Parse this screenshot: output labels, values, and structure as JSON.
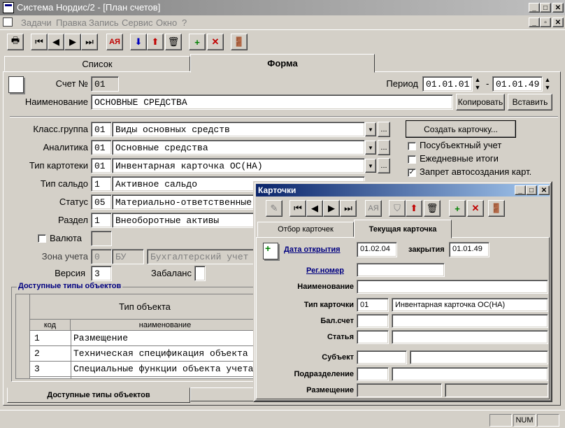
{
  "app": {
    "title": "Система Нордис/2 - [План счетов]",
    "menu": [
      "Задачи",
      "Правка",
      "Запись",
      "Сервис",
      "Окно",
      "?"
    ]
  },
  "tabs": {
    "list": "Список",
    "form": "Форма"
  },
  "form": {
    "account_label": "Счет №",
    "account_value": "01",
    "period_label": "Период",
    "period_from": "01.01.01",
    "period_sep": "-",
    "period_to": "01.01.49",
    "name_label": "Наименование",
    "name_value": "ОСНОВНЫЕ СРЕДСТВА",
    "copy_button": "Копировать",
    "paste_button": "Вставить",
    "class_group_label": "Класс.группа",
    "class_group_code": "01",
    "class_group_value": "Виды основных средств",
    "analytics_label": "Аналитика",
    "analytics_code": "01",
    "analytics_value": "Основные средства",
    "card_type_label": "Тип картотеки",
    "card_type_code": "01",
    "card_type_value": "Инвентарная карточка ОС(НА)",
    "balance_type_label": "Тип сальдо",
    "balance_type_code": "1",
    "balance_type_value": "Активное сальдо",
    "status_label": "Статус",
    "status_code": "05",
    "status_value": "Материально-ответственные",
    "section_label": "Раздел",
    "section_code": "1",
    "section_value": "Внеоборотные активы",
    "currency_label": "Валюта",
    "zone_label": "Зона учета",
    "zone_code": "0",
    "zone_short": "БУ",
    "zone_value": "Бухгалтерский учет",
    "version_label": "Версия",
    "version_value": "3",
    "offbalance_label": "Забаланс",
    "create_card_button": "Создать карточку...",
    "ellipsis": "...",
    "checks": [
      {
        "label": "Посубъектный учет",
        "checked": false
      },
      {
        "label": "Ежедневные итоги",
        "checked": false
      },
      {
        "label": "Запрет автосоздания карт.",
        "checked": true
      }
    ]
  },
  "objects": {
    "group_title": "Доступные типы объектов",
    "header": "Тип объекта",
    "col_code": "код",
    "col_name": "наименование",
    "rows": [
      {
        "code": "1",
        "name": "Размещение"
      },
      {
        "code": "2",
        "name": "Техническая спецификация объекта"
      },
      {
        "code": "3",
        "name": "Специальные функции объекта учета"
      }
    ]
  },
  "bottom_tabs": {
    "active": "Доступные типы объектов"
  },
  "status_bar": {
    "num": "NUM"
  },
  "cards": {
    "title": "Карточки",
    "tab_filter": "Отбор карточек",
    "tab_current": "Текущая карточка",
    "open_date_label": "Дата открытия",
    "open_date_value": "01.02.04",
    "close_label": "закрытия",
    "close_value": "01.01.49",
    "reg_number_label": "Рег.номер",
    "name_label": "Наименование",
    "card_type_label": "Тип карточки",
    "card_type_code": "01",
    "card_type_value": "Инвентарная карточка ОС(НА)",
    "bal_account_label": "Бал.счет",
    "article_label": "Статья",
    "subject_label": "Субъект",
    "department_label": "Подразделение",
    "placement_label": "Размещение"
  }
}
